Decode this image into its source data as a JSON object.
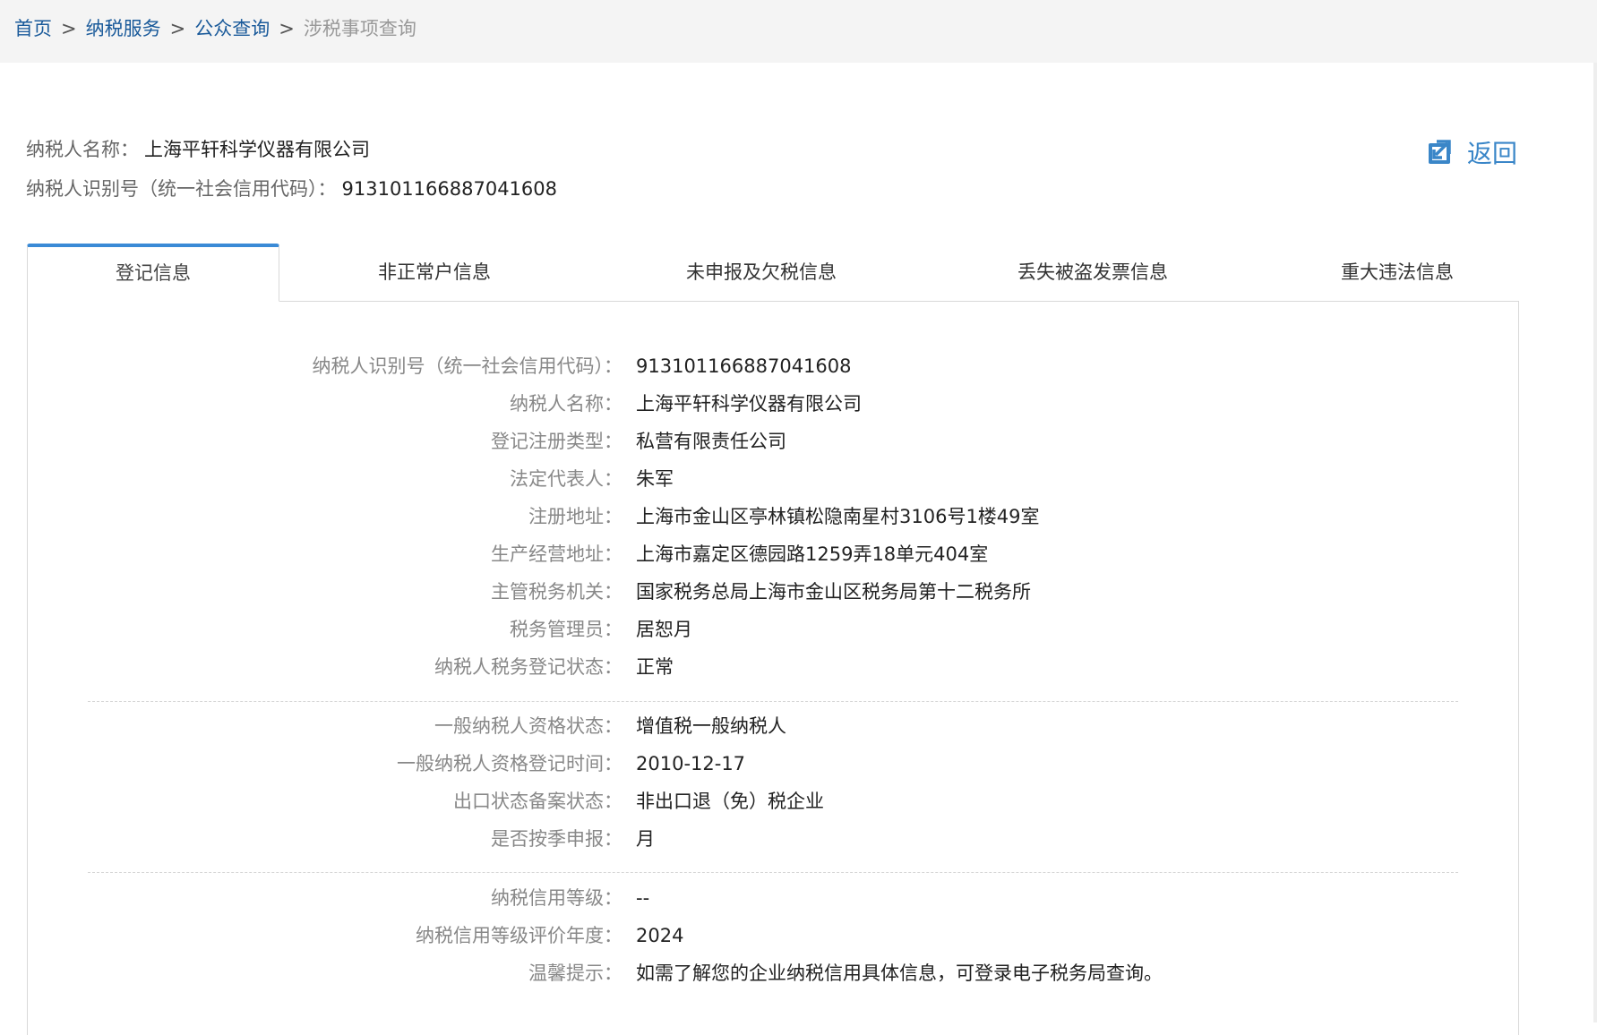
{
  "breadcrumb": {
    "items": [
      "首页",
      "纳税服务",
      "公众查询"
    ],
    "current": "涉税事项查询",
    "separator": ">"
  },
  "summary": {
    "name_label": "纳税人名称：",
    "name_value": "上海平轩科学仪器有限公司",
    "id_label": "纳税人识别号（统一社会信用代码）：",
    "id_value": "913101166887041608"
  },
  "back": {
    "label": "返回",
    "icon": "return-icon"
  },
  "tabs": [
    {
      "label": "登记信息",
      "active": true
    },
    {
      "label": "非正常户信息",
      "active": false
    },
    {
      "label": "未申报及欠税信息",
      "active": false
    },
    {
      "label": "丢失被盗发票信息",
      "active": false
    },
    {
      "label": "重大违法信息",
      "active": false
    }
  ],
  "registration": {
    "group1": [
      {
        "label": "纳税人识别号（统一社会信用代码）：",
        "value": "913101166887041608"
      },
      {
        "label": "纳税人名称：",
        "value": "上海平轩科学仪器有限公司"
      },
      {
        "label": "登记注册类型：",
        "value": "私营有限责任公司"
      },
      {
        "label": "法定代表人：",
        "value": "朱军"
      },
      {
        "label": "注册地址：",
        "value": "上海市金山区亭林镇松隐南星村3106号1楼49室"
      },
      {
        "label": "生产经营地址：",
        "value": "上海市嘉定区德园路1259弄18单元404室"
      },
      {
        "label": "主管税务机关：",
        "value": "国家税务总局上海市金山区税务局第十二税务所"
      },
      {
        "label": "税务管理员：",
        "value": "居恕月"
      },
      {
        "label": "纳税人税务登记状态：",
        "value": "正常"
      }
    ],
    "group2": [
      {
        "label": "一般纳税人资格状态：",
        "value": "增值税一般纳税人"
      },
      {
        "label": "一般纳税人资格登记时间：",
        "value": "2010-12-17"
      },
      {
        "label": "出口状态备案状态：",
        "value": "非出口退（免）税企业"
      },
      {
        "label": "是否按季申报：",
        "value": "月"
      }
    ],
    "group3": [
      {
        "label": "纳税信用等级：",
        "value": "--"
      },
      {
        "label": "纳税信用等级评价年度：",
        "value": "2024"
      },
      {
        "label": "温馨提示：",
        "value": "如需了解您的企业纳税信用具体信息，可登录电子税务局查询。"
      }
    ]
  },
  "colors": {
    "link": "#1a5a9a",
    "accent": "#3a8ad6",
    "label": "#888888",
    "value": "#222222"
  }
}
